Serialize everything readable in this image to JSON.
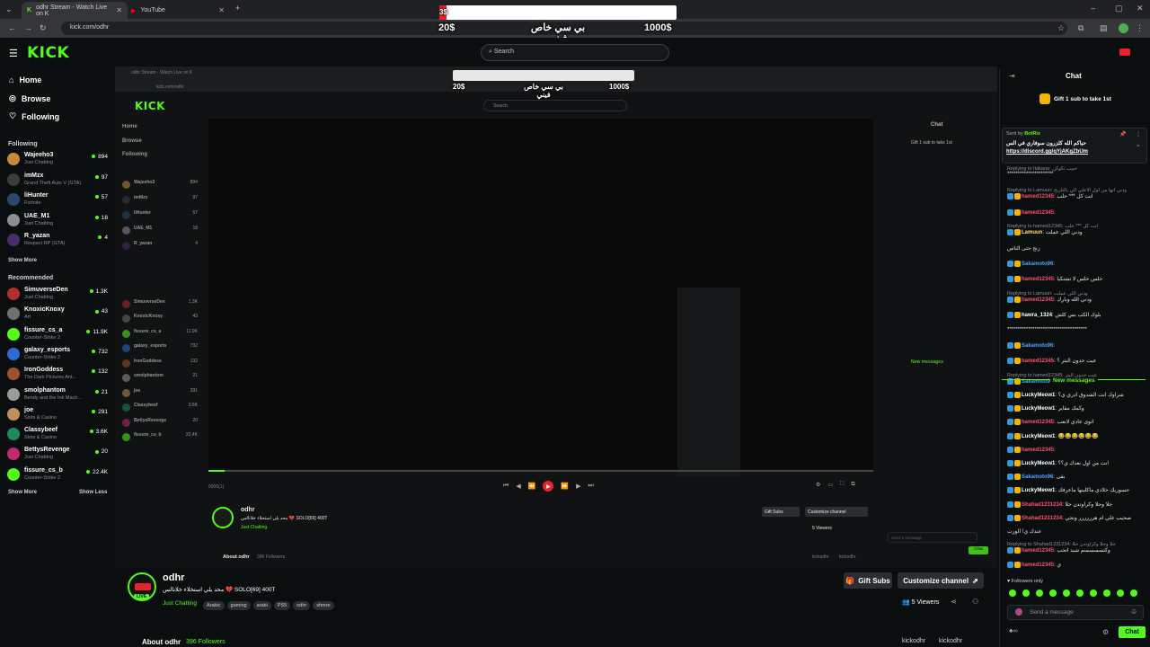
{
  "browser": {
    "tabs": [
      {
        "label": "odhr Stream - Watch Live on K",
        "active": true
      },
      {
        "label": "YouTube",
        "active": false
      }
    ],
    "url": "kick.com/odhr"
  },
  "overlay": {
    "left_amount": "20$",
    "title": "بي سي خاص فيني",
    "right_amount": "1000$",
    "progress_label": "3$"
  },
  "topbar": {
    "logo": "KICK",
    "search_placeholder": "Search"
  },
  "sidebar": {
    "nav": [
      {
        "label": "Home",
        "icon": "home-icon"
      },
      {
        "label": "Browse",
        "icon": "compass-icon"
      },
      {
        "label": "Following",
        "icon": "heart-icon"
      }
    ],
    "following_title": "Following",
    "following": [
      {
        "name": "Wajeeho3",
        "game": "Just Chatting",
        "viewers": "894",
        "color": "#c68a3a"
      },
      {
        "name": "imMzx",
        "game": "Grand Theft Auto V (GTA)",
        "viewers": "97",
        "color": "#3c3c3c"
      },
      {
        "name": "liHunter",
        "game": "Fortnite",
        "viewers": "57",
        "color": "#2b4a6b"
      },
      {
        "name": "UAE_M1",
        "game": "Just Chatting",
        "viewers": "18",
        "color": "#8a8f94"
      },
      {
        "name": "R_yazan",
        "game": "Respect RP (GTA)",
        "viewers": "4",
        "color": "#4a2b6b"
      }
    ],
    "show_more": "Show More",
    "recommended_title": "Recommended",
    "recommended": [
      {
        "name": "SimuverseDen",
        "game": "Just Chatting",
        "viewers": "1.3K",
        "color": "#b03030"
      },
      {
        "name": "KnoxicKnoxy",
        "game": "Art",
        "viewers": "43",
        "color": "#707070"
      },
      {
        "name": "fissure_cs_a",
        "game": "Counter-Strike 2",
        "viewers": "11.9K",
        "color": "#53fc18"
      },
      {
        "name": "galaxy_esports",
        "game": "Counter-Strike 2",
        "viewers": "732",
        "color": "#2e6bd6"
      },
      {
        "name": "IronGoddess",
        "game": "The Dark Pictures Ant...",
        "viewers": "132",
        "color": "#a0522d"
      },
      {
        "name": "smolphantom",
        "game": "Bendy and the Ink Mach...",
        "viewers": "21",
        "color": "#9a9a9a"
      },
      {
        "name": "joe",
        "game": "Slots & Casino",
        "viewers": "291",
        "color": "#c0905a"
      },
      {
        "name": "Classybeef",
        "game": "Slots & Casino",
        "viewers": "3.6K",
        "color": "#1e8a5a"
      },
      {
        "name": "BettysRevenge",
        "game": "Just Chatting",
        "viewers": "20",
        "color": "#c02a70"
      },
      {
        "name": "fissure_cs_b",
        "game": "Counter-Strike 2",
        "viewers": "22.4K",
        "color": "#53fc18"
      }
    ],
    "show_less": "Show Less"
  },
  "player": {
    "time": "0906(1)"
  },
  "stream": {
    "channel": "odhr",
    "title": "محد يلي استخلاء خلانالس 💔 SOLO[69] 400T",
    "category": "Just Chatting",
    "tags": [
      "Arabic",
      "gaming",
      "arabi",
      "PS5",
      "odhr",
      "shmre"
    ],
    "viewers": "5 Viewers",
    "gift_label": "Gift Subs",
    "customize_label": "Customize channel",
    "about_label": "About odhr",
    "followers": "396 Followers",
    "social_1": "kickodhr",
    "social_2": "kickodhr"
  },
  "chat": {
    "title": "Chat",
    "gift_banner": "Gift 1 sub to take 1st",
    "pinned_sender": "Sent by",
    "pinned_user": "BotRix",
    "pinned_text": "حياكم الله كلزرون سوفاري في الس",
    "pinned_link": "https://discord.gg/qYjAKgZbUm",
    "new_messages": "New messages",
    "followers_only": "Followers only",
    "send_placeholder": "Send a message",
    "send_button": "Chat",
    "messages": [
      {
        "reply": "Replying to Itakana: حبيب تكوكن",
        "user": "",
        "text": "**********************"
      },
      {
        "reply": "Replying to Lamuun: ودني انها من أول الاعلي الي بالتاريخ",
        "user": "hamed12345",
        "text": "انت كل *** حلب"
      },
      {
        "reply": "",
        "user": "hamed12345",
        "text": ""
      },
      {
        "reply": "Replying to hamed12345: انت كل *** حلب",
        "user": "Lamuun",
        "text": "ودني اللي عملت"
      },
      {
        "reply": "",
        "user": "",
        "text": "زنج حتى الناس"
      },
      {
        "reply": "",
        "user": "Sakamoto96",
        "text": ""
      },
      {
        "reply": "",
        "user": "hamed12345",
        "text": "خلس خلس لا تشتكيا"
      },
      {
        "reply": "Replying to Lamuun: ودني اللي عملت",
        "user": "hamed12345",
        "text": "ودني الله وبارك"
      },
      {
        "reply": "",
        "user": "hawra_1324",
        "text": "بلوك الكب بس كلش"
      },
      {
        "reply": "",
        "user": "",
        "text": "**************************************"
      },
      {
        "reply": "",
        "user": "Sakamoto96",
        "text": ""
      },
      {
        "reply": "",
        "user": "hamed12345",
        "text": "عيت حدون البثر ؟"
      },
      {
        "reply": "Replying to hamed12345: عيت حدون البثر",
        "user": "Sakamoto96",
        "text": "****"
      }
    ],
    "new_msgs": [
      {
        "reply": "",
        "user": "LuckyMeow1",
        "text": "شراوك انت الشدوق ادري ي؟"
      },
      {
        "reply": "",
        "user": "LuckyMeow1",
        "text": "وكمك مقاير"
      },
      {
        "reply": "",
        "user": "hamed12345",
        "text": "اتوى عادي لانعب"
      },
      {
        "reply": "",
        "user": "LuckyMeow1",
        "text": "😂😂😂😂😂😂"
      },
      {
        "reply": "",
        "user": "hamed12345",
        "text": ""
      },
      {
        "reply": "",
        "user": "LuckyMeow1",
        "text": "انت من اول نعذك ي؟؟"
      },
      {
        "reply": "",
        "user": "Sakamoto96",
        "text": "بقى"
      },
      {
        "reply": "",
        "user": "LuckyMeow1",
        "text": "حسوريك خلادي ماكلينها ماعرفك"
      },
      {
        "reply": "",
        "user": "Shahad1231234",
        "text": "حلا وحلا وكراوتدن حلا"
      },
      {
        "reply": "",
        "user": "Shahad1231234",
        "text": "صحيب علي ام هرررررر وتجي"
      },
      {
        "reply": "",
        "user": "",
        "text": "عندك ي! الورت"
      },
      {
        "reply": "Replying to Shahad1231234: حلا وحلا وكراوتدن حلا",
        "user": "hamed12345",
        "text": "وكتسسسسم شيد اتجب"
      },
      {
        "reply": "",
        "user": "hamed12345",
        "text": "ي"
      }
    ]
  },
  "colors": {
    "accent": "#53fc18",
    "bg": "#0b0e0f",
    "red": "#e8242a"
  }
}
